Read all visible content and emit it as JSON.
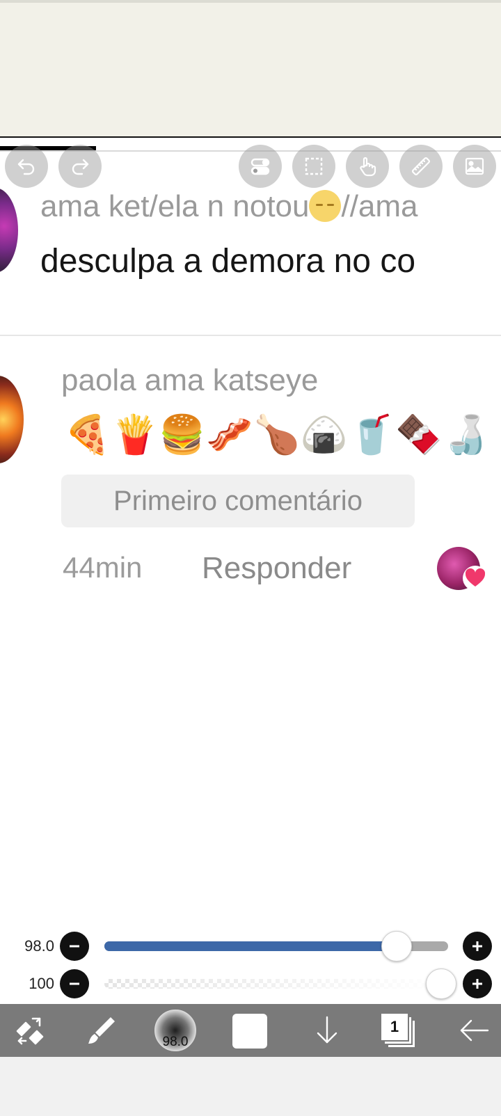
{
  "comment_1": {
    "username": "ama ket/ela n notou",
    "username_suffix": "//ama",
    "emoji": "pensive-face",
    "text": "desculpa a demora no co"
  },
  "comment_2": {
    "username": "paola ama katseye",
    "emojis": [
      "🍕",
      "🍟",
      "🍔",
      "🥓",
      "🍗",
      "🍙",
      "🥤",
      "🍫",
      "🍶"
    ],
    "badge": "Primeiro comentário",
    "time": "44min",
    "reply": "Responder",
    "liked_by_creator": true
  },
  "toolbar_top": {
    "icons": [
      "undo-icon",
      "redo-icon",
      "toggle-icon",
      "selection-icon",
      "hand-icon",
      "ruler-icon",
      "image-icon"
    ]
  },
  "brush_size": {
    "label": "98.0",
    "fraction": 0.85
  },
  "opacity": {
    "label": "100",
    "fraction": 1.0
  },
  "bottom_toolbar": {
    "brush_preview_label": "98.0",
    "layer_number": "1",
    "color": "#ffffff",
    "icons": [
      "transform-icon",
      "brush-icon",
      "brush-size-preview",
      "color-swatch",
      "download-icon",
      "layers-icon",
      "back-arrow-icon"
    ]
  },
  "colors": {
    "slider_fill": "#3d68a8",
    "toolbar_bg": "#7a7a7a",
    "heart": "#f0386b"
  }
}
